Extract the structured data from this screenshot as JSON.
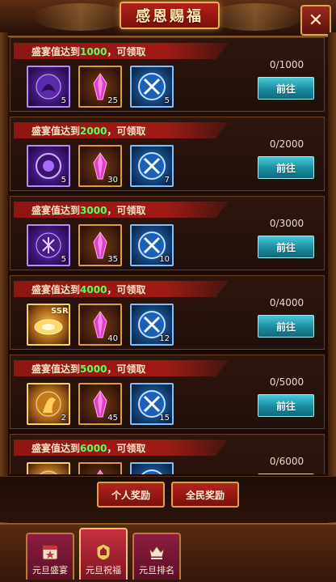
{
  "title": "感恩赐福",
  "close_icon": "close-icon",
  "cards": [
    {
      "title_prefix": "盛宴值达到",
      "threshold": "1000",
      "title_suffix": "，可领取",
      "progress": "0/1000",
      "button": "前往",
      "items": [
        {
          "rarity": "purple",
          "icon": "beast-portrait-icon",
          "count": "5",
          "badge": ""
        },
        {
          "rarity": "orange",
          "icon": "pink-crystal-icon",
          "count": "25",
          "badge": ""
        },
        {
          "rarity": "blue",
          "icon": "crossed-swords-icon",
          "count": "5",
          "badge": ""
        }
      ]
    },
    {
      "title_prefix": "盛宴值达到",
      "threshold": "2000",
      "title_suffix": "，可领取",
      "progress": "0/2000",
      "button": "前往",
      "items": [
        {
          "rarity": "purple",
          "icon": "purple-orb-icon",
          "count": "5",
          "badge": ""
        },
        {
          "rarity": "orange",
          "icon": "pink-crystal-icon",
          "count": "30",
          "badge": ""
        },
        {
          "rarity": "blue",
          "icon": "crossed-swords-icon",
          "count": "7",
          "badge": ""
        }
      ]
    },
    {
      "title_prefix": "盛宴值达到",
      "threshold": "3000",
      "title_suffix": "，可领取",
      "progress": "0/3000",
      "button": "前往",
      "items": [
        {
          "rarity": "purple",
          "icon": "purple-rune-icon",
          "count": "5",
          "badge": ""
        },
        {
          "rarity": "orange",
          "icon": "pink-crystal-icon",
          "count": "35",
          "badge": ""
        },
        {
          "rarity": "blue",
          "icon": "crossed-swords-icon",
          "count": "10",
          "badge": ""
        }
      ]
    },
    {
      "title_prefix": "盛宴值达到",
      "threshold": "4000",
      "title_suffix": "，可领取",
      "progress": "0/4000",
      "button": "前往",
      "items": [
        {
          "rarity": "gold",
          "icon": "ssr-gold-shard-icon",
          "count": "",
          "badge": "SSR"
        },
        {
          "rarity": "orange",
          "icon": "pink-crystal-icon",
          "count": "40",
          "badge": ""
        },
        {
          "rarity": "blue",
          "icon": "crossed-swords-icon",
          "count": "12",
          "badge": ""
        }
      ]
    },
    {
      "title_prefix": "盛宴值达到",
      "threshold": "5000",
      "title_suffix": "，可领取",
      "progress": "0/5000",
      "button": "前往",
      "items": [
        {
          "rarity": "gold",
          "icon": "gold-warrior-icon",
          "count": "2",
          "badge": ""
        },
        {
          "rarity": "orange",
          "icon": "pink-crystal-icon",
          "count": "45",
          "badge": ""
        },
        {
          "rarity": "blue",
          "icon": "crossed-swords-icon",
          "count": "15",
          "badge": ""
        }
      ]
    },
    {
      "title_prefix": "盛宴值达到",
      "threshold": "6000",
      "title_suffix": "，可领取",
      "progress": "0/6000",
      "button": "前往",
      "items": [
        {
          "rarity": "gold",
          "icon": "gold-item-icon",
          "count": "",
          "badge": ""
        },
        {
          "rarity": "orange",
          "icon": "pink-crystal-icon",
          "count": "",
          "badge": ""
        },
        {
          "rarity": "blue",
          "icon": "crossed-swords-icon",
          "count": "",
          "badge": ""
        }
      ]
    }
  ],
  "reward_tabs": {
    "personal": "个人奖励",
    "all": "全民奖励"
  },
  "footer_tabs": [
    {
      "label": "元旦盛宴",
      "icon": "calendar-star-icon",
      "active": false
    },
    {
      "label": "元旦祝福",
      "icon": "blessing-crest-icon",
      "active": true
    },
    {
      "label": "元旦排名",
      "icon": "ranking-crown-icon",
      "active": false
    }
  ],
  "colors": {
    "threshold_green": "#5eff5e",
    "goto_button": "#1a8da0",
    "banner_red": "#a11b16"
  }
}
